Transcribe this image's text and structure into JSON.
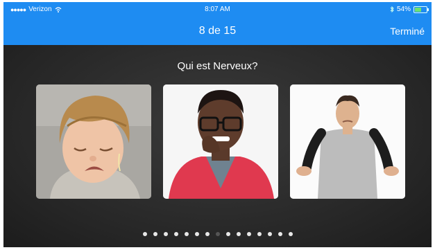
{
  "status_bar": {
    "signal": "●●●●●",
    "carrier": "Verizon",
    "time": "8:07 AM",
    "battery_text": "54%",
    "battery_level": 0.54
  },
  "nav": {
    "title": "8 de 15",
    "done_label": "Terminé"
  },
  "question": "Qui est Nerveux?",
  "answers": [
    {
      "image": "crying-boy-photo"
    },
    {
      "image": "nervous-young-man-photo"
    },
    {
      "image": "shrugging-man-photo"
    }
  ],
  "pager": {
    "total": 15,
    "current": 8
  },
  "colors": {
    "accent": "#1e8cf2",
    "background": "#262626"
  }
}
